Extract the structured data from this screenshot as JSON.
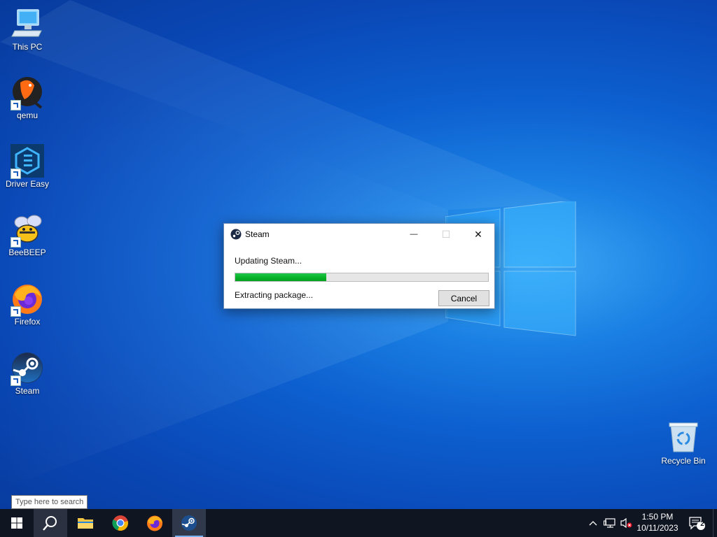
{
  "desktop": {
    "icons": [
      {
        "label": "This PC",
        "icon": "this-pc-icon"
      },
      {
        "label": "qemu",
        "icon": "qemu-icon"
      },
      {
        "label": "Driver Easy",
        "icon": "driver-easy-icon"
      },
      {
        "label": "BeeBEEP",
        "icon": "beebeep-icon"
      },
      {
        "label": "Firefox",
        "icon": "firefox-icon"
      },
      {
        "label": "Steam",
        "icon": "steam-icon"
      }
    ],
    "recycle_bin": {
      "label": "Recycle Bin",
      "icon": "recycle-bin-icon"
    }
  },
  "dialog": {
    "title": "Steam",
    "status": "Updating Steam...",
    "progress_fraction": 0.36,
    "detail": "Extracting package...",
    "cancel_label": "Cancel",
    "minimize_glyph": "—",
    "maximize_glyph": "☐",
    "close_glyph": "✕",
    "progress_color": "#06b025"
  },
  "taskbar": {
    "search_tooltip": "Type here to search",
    "apps": [
      "start-icon",
      "search-icon",
      "file-explorer-icon",
      "chrome-icon",
      "firefox-icon",
      "steam-icon"
    ],
    "clock_time": "1:50 PM",
    "clock_date": "10/11/2023",
    "notification_count": "2"
  },
  "colors": {
    "taskbar_bg": "#101522",
    "desktop_accent": "#0d5fcf"
  }
}
